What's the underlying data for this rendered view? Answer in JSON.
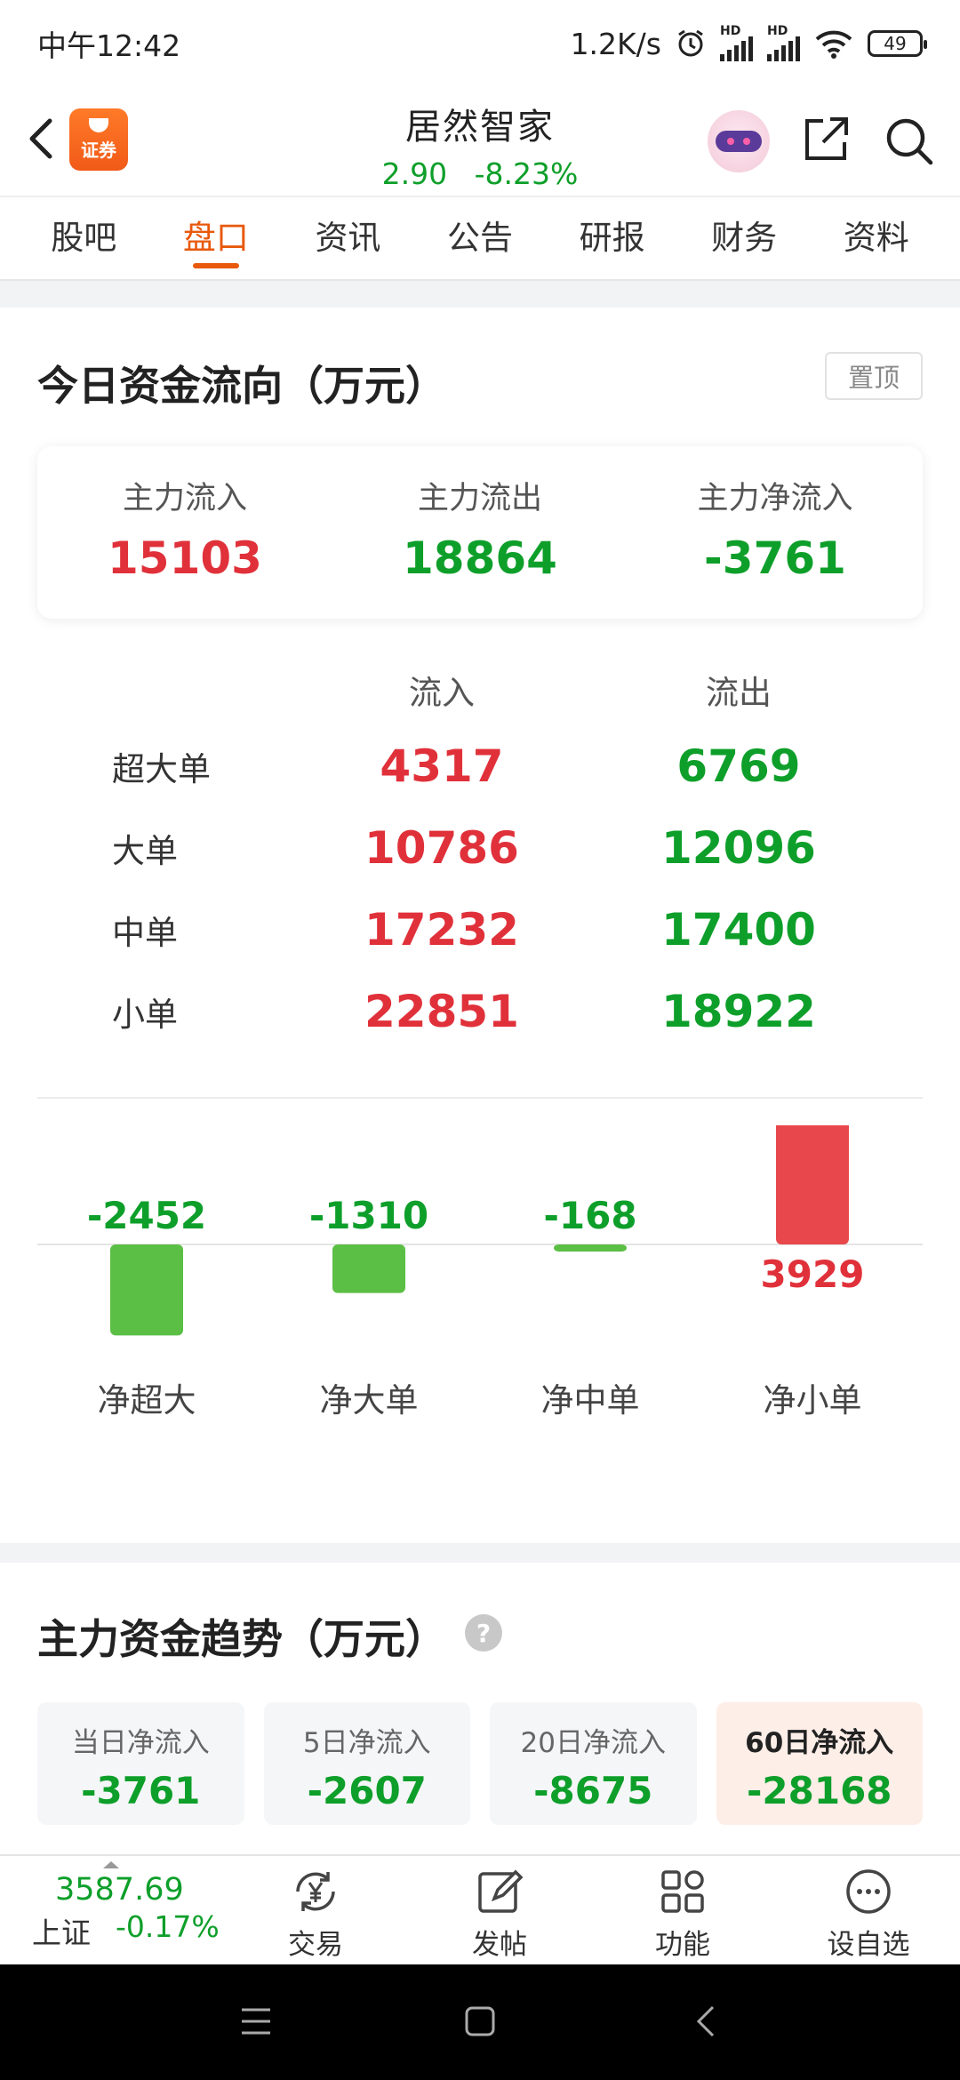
{
  "status_bar": {
    "time": "中午12:42",
    "net_speed": "1.2K/s",
    "battery": "49",
    "hd1": "HD",
    "hd2": "HD"
  },
  "header": {
    "logo_text": "证券",
    "stock_name": "居然智家",
    "price": "2.90",
    "change_pct": "-8.23%"
  },
  "tabs": [
    {
      "label": "股吧"
    },
    {
      "label": "盘口",
      "active": true
    },
    {
      "label": "资讯"
    },
    {
      "label": "公告"
    },
    {
      "label": "研报"
    },
    {
      "label": "财务"
    },
    {
      "label": "资料"
    }
  ],
  "fund_flow": {
    "title": "今日资金流向（万元）",
    "pin_label": "置顶",
    "summary": {
      "inflow_label": "主力流入",
      "inflow_value": "15103",
      "outflow_label": "主力流出",
      "outflow_value": "18864",
      "net_label": "主力净流入",
      "net_value": "-3761"
    },
    "table_headers": {
      "inflow": "流入",
      "outflow": "流出"
    },
    "rows": [
      {
        "label": "超大单",
        "inflow": "4317",
        "outflow": "6769"
      },
      {
        "label": "大单",
        "inflow": "10786",
        "outflow": "12096"
      },
      {
        "label": "中单",
        "inflow": "17232",
        "outflow": "17400"
      },
      {
        "label": "小单",
        "inflow": "22851",
        "outflow": "18922"
      }
    ]
  },
  "chart_data": {
    "type": "bar",
    "categories": [
      "净超大",
      "净大单",
      "净中单",
      "净小单"
    ],
    "values": [
      -2452,
      -1310,
      -168,
      3929
    ],
    "data_labels": [
      "-2452",
      "-1310",
      "-168",
      "3929"
    ],
    "colors": {
      "positive": "#e8484c",
      "negative": "#5bbf45"
    },
    "ylim": [
      -2452,
      3929
    ]
  },
  "trend": {
    "title": "主力资金趋势（万元）",
    "help_icon": "?",
    "boxes": [
      {
        "label": "当日净流入",
        "value": "-3761"
      },
      {
        "label": "5日净流入",
        "value": "-2607"
      },
      {
        "label": "20日净流入",
        "value": "-8675"
      },
      {
        "label": "60日净流入",
        "value": "-28168",
        "active": true
      }
    ]
  },
  "bottom_nav": {
    "index_value": "3587.69",
    "index_name": "上证",
    "index_change": "-0.17%",
    "items": [
      {
        "label": "交易",
        "icon": "yuan-exchange-icon"
      },
      {
        "label": "发帖",
        "icon": "edit-icon"
      },
      {
        "label": "功能",
        "icon": "grid-icon"
      },
      {
        "label": "设自选",
        "icon": "more-icon"
      }
    ]
  },
  "colors": {
    "accent": "#e8590c",
    "up_red": "#e0313a",
    "down_green": "#0e9f2a"
  }
}
